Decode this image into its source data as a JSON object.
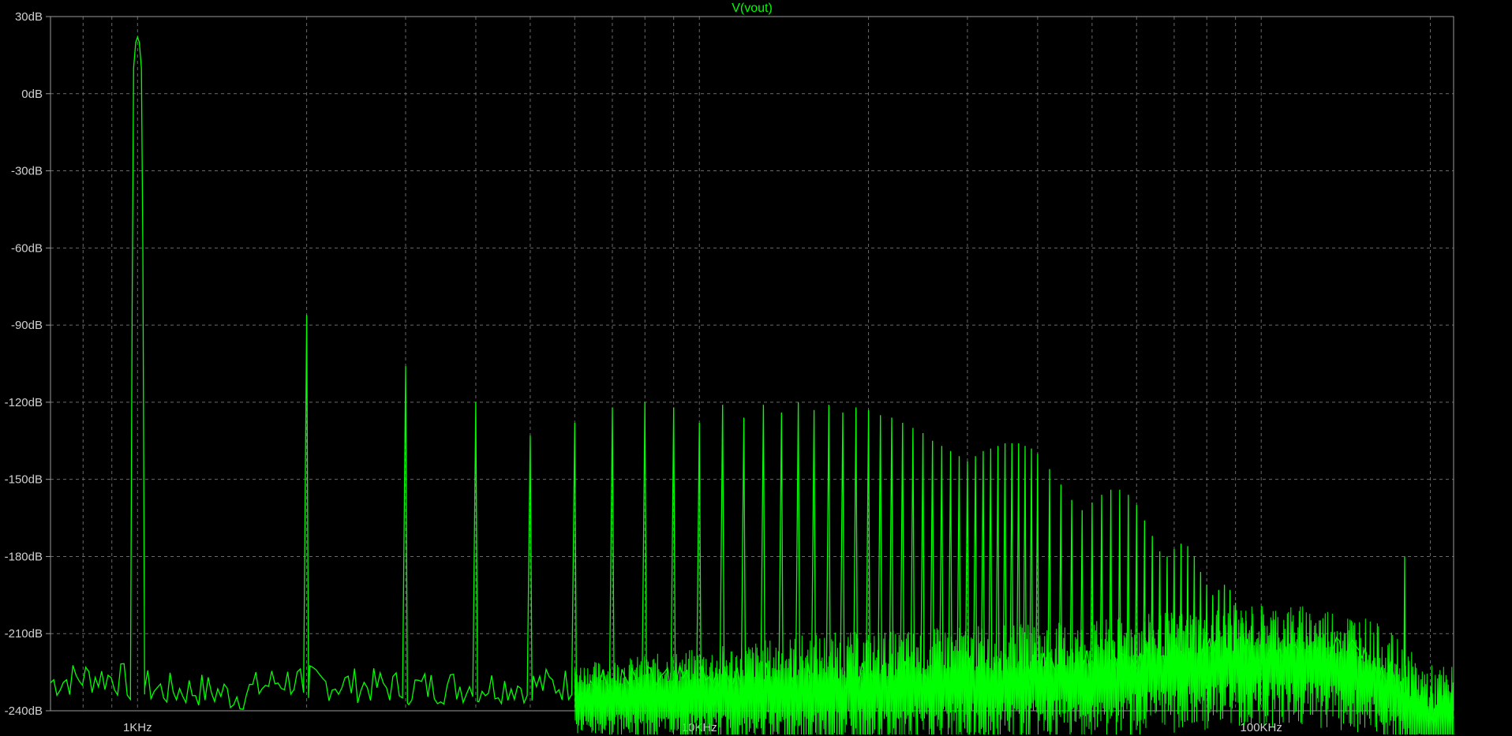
{
  "chart_data": {
    "type": "line",
    "title": "V(vout)",
    "x_scale": "log",
    "y_scale": "linear",
    "xlim": [
      700,
      220000
    ],
    "ylim": [
      -240,
      30
    ],
    "grid": true,
    "y_ticks": [
      {
        "value": 30,
        "label": "30dB"
      },
      {
        "value": 0,
        "label": "0dB"
      },
      {
        "value": -30,
        "label": "-30dB"
      },
      {
        "value": -60,
        "label": "-60dB"
      },
      {
        "value": -90,
        "label": "-90dB"
      },
      {
        "value": -120,
        "label": "-120dB"
      },
      {
        "value": -150,
        "label": "-150dB"
      },
      {
        "value": -180,
        "label": "-180dB"
      },
      {
        "value": -210,
        "label": "-210dB"
      },
      {
        "value": -240,
        "label": "-240dB"
      }
    ],
    "x_ticks": [
      {
        "value": 1000,
        "label": "1KHz"
      },
      {
        "value": 10000,
        "label": "10KHz"
      },
      {
        "value": 100000,
        "label": "100KHz"
      }
    ],
    "series": [
      {
        "name": "V(vout)",
        "color": "#00ff00",
        "peaks": [
          [
            1000,
            22
          ],
          [
            2000,
            -86
          ],
          [
            3000,
            -106
          ],
          [
            4000,
            -120
          ],
          [
            5000,
            -133
          ],
          [
            6000,
            -128
          ],
          [
            7000,
            -122
          ],
          [
            8000,
            -120
          ],
          [
            9000,
            -122
          ],
          [
            10000,
            -128
          ],
          [
            11000,
            -121
          ],
          [
            12000,
            -126
          ],
          [
            13000,
            -121
          ],
          [
            14000,
            -124
          ],
          [
            15000,
            -120
          ],
          [
            16000,
            -123
          ],
          [
            17000,
            -121
          ],
          [
            18000,
            -124
          ],
          [
            19000,
            -122
          ],
          [
            20000,
            -123
          ],
          [
            21000,
            -125
          ],
          [
            22000,
            -126
          ],
          [
            23000,
            -128
          ],
          [
            24000,
            -130
          ],
          [
            25000,
            -132
          ],
          [
            26000,
            -135
          ],
          [
            27000,
            -137
          ],
          [
            28000,
            -139
          ],
          [
            29000,
            -141
          ],
          [
            30000,
            -143
          ],
          [
            31000,
            -141
          ],
          [
            32000,
            -139
          ],
          [
            33000,
            -138
          ],
          [
            34000,
            -137
          ],
          [
            35000,
            -136
          ],
          [
            36000,
            -136
          ],
          [
            37000,
            -136
          ],
          [
            38000,
            -137
          ],
          [
            39000,
            -138
          ],
          [
            40000,
            -140
          ],
          [
            42000,
            -146
          ],
          [
            44000,
            -152
          ],
          [
            46000,
            -158
          ],
          [
            48000,
            -162
          ],
          [
            50000,
            -159
          ],
          [
            52000,
            -156
          ],
          [
            54000,
            -154
          ],
          [
            56000,
            -154
          ],
          [
            58000,
            -156
          ],
          [
            60000,
            -160
          ],
          [
            62000,
            -166
          ],
          [
            64000,
            -172
          ],
          [
            66000,
            -178
          ],
          [
            68000,
            -180
          ],
          [
            70000,
            -177
          ],
          [
            72000,
            -175
          ],
          [
            74000,
            -176
          ],
          [
            76000,
            -180
          ],
          [
            78000,
            -186
          ],
          [
            80000,
            -191
          ],
          [
            82000,
            -195
          ],
          [
            84000,
            -193
          ],
          [
            86000,
            -191
          ],
          [
            88000,
            -193
          ],
          [
            90000,
            -198
          ],
          [
            92000,
            -206
          ],
          [
            94000,
            -205
          ],
          [
            96000,
            -207
          ],
          [
            100000,
            -210
          ],
          [
            110000,
            -216
          ],
          [
            180000,
            -180
          ]
        ],
        "noise_floor": [
          [
            700,
            -229
          ],
          [
            800,
            -227
          ],
          [
            900,
            -227
          ],
          [
            1100,
            -232
          ],
          [
            1300,
            -232
          ],
          [
            1500,
            -234
          ],
          [
            1800,
            -228
          ],
          [
            2000,
            -229
          ],
          [
            3000,
            -231
          ],
          [
            5000,
            -230
          ],
          [
            10000,
            -229
          ],
          [
            20000,
            -227
          ],
          [
            30000,
            -225
          ],
          [
            50000,
            -223
          ],
          [
            70000,
            -219
          ],
          [
            100000,
            -216
          ],
          [
            130000,
            -217
          ],
          [
            150000,
            -220
          ],
          [
            170000,
            -227
          ],
          [
            180000,
            -233
          ],
          [
            200000,
            -240
          ]
        ]
      }
    ]
  }
}
